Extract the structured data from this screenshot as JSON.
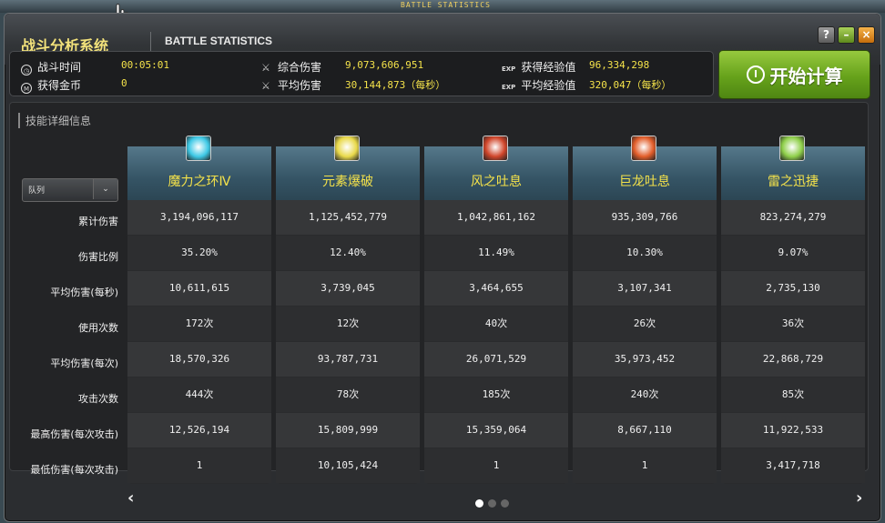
{
  "window": {
    "top_strip_title": "BATTLE STATISTICS",
    "title_cn": "战斗分析系统",
    "title_en": "BATTLE STATISTICS",
    "help_label": "?",
    "minimize_label": "–",
    "close_label": "×"
  },
  "stats": {
    "battle_time": {
      "label": "战斗时间",
      "value": "00:05:01"
    },
    "gold": {
      "label": "获得金币",
      "value": "0"
    },
    "total_damage": {
      "label": "综合伤害",
      "value": "9,073,606,951"
    },
    "avg_damage": {
      "label": "平均伤害",
      "value": "30,144,873（每秒）"
    },
    "exp_total": {
      "label": "获得经验值",
      "value": "96,334,298"
    },
    "exp_avg": {
      "label": "平均经验值",
      "value": "320,047（每秒）"
    },
    "exp_tag": "EXP",
    "time_icon": "clock-icon",
    "gold_icon": "coin-icon"
  },
  "calc_button": {
    "label": "开始计算"
  },
  "section": {
    "label": "技能详细信息"
  },
  "sort_dropdown": {
    "label": "队列"
  },
  "row_labels": [
    "累计伤害",
    "伤害比例",
    "平均伤害(每秒)",
    "使用次数",
    "平均伤害(每次)",
    "攻击次数",
    "最高伤害(每次攻击)",
    "最低伤害(每次攻击)"
  ],
  "skills": [
    {
      "name": "魔力之环Ⅳ",
      "color": "#3ec9e6",
      "values": [
        "3,194,096,117",
        "35.20%",
        "10,611,615",
        "172次",
        "18,570,326",
        "444次",
        "12,526,194",
        "1"
      ]
    },
    {
      "name": "元素爆破",
      "color": "#e9d94a",
      "values": [
        "1,125,452,779",
        "12.40%",
        "3,739,045",
        "12次",
        "93,787,731",
        "78次",
        "15,809,999",
        "10,105,424"
      ]
    },
    {
      "name": "风之吐息",
      "color": "#d0452a",
      "values": [
        "1,042,861,162",
        "11.49%",
        "3,464,655",
        "40次",
        "26,071,529",
        "185次",
        "15,359,064",
        "1"
      ]
    },
    {
      "name": "巨龙吐息",
      "color": "#e25d2a",
      "values": [
        "935,309,766",
        "10.30%",
        "3,107,341",
        "26次",
        "35,973,452",
        "240次",
        "8,667,110",
        "1"
      ]
    },
    {
      "name": "雷之迅捷",
      "color": "#8fcf4a",
      "values": [
        "823,274,279",
        "9.07%",
        "2,735,130",
        "36次",
        "22,868,729",
        "85次",
        "11,922,533",
        "3,417,718"
      ]
    }
  ],
  "pager": {
    "prev": "‹",
    "next": "›",
    "pages": 3,
    "current": 1
  }
}
